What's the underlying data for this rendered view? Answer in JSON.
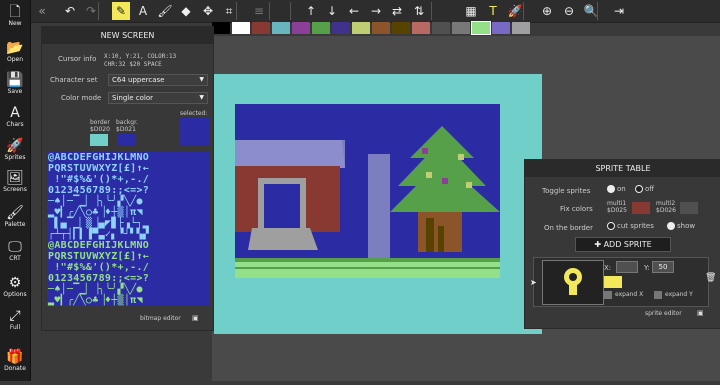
{
  "sidebar": {
    "items": [
      {
        "label": "New",
        "icon": "file-icon",
        "glyph": "🗋"
      },
      {
        "label": "Open",
        "icon": "folder-icon",
        "glyph": "📂"
      },
      {
        "label": "Save",
        "icon": "save-icon",
        "glyph": "💾"
      },
      {
        "label": "Chars",
        "icon": "chars-icon",
        "glyph": "A"
      },
      {
        "label": "Sprites",
        "icon": "rocket-icon",
        "glyph": "🚀"
      },
      {
        "label": "Screens",
        "icon": "image-icon",
        "glyph": "🖼"
      },
      {
        "label": "Palette",
        "icon": "brush-icon",
        "glyph": "🖌"
      },
      {
        "label": "CRT",
        "icon": "monitor-icon",
        "glyph": "🖵"
      },
      {
        "label": "Options",
        "icon": "gear-icon",
        "glyph": "⚙"
      },
      {
        "label": "Full",
        "icon": "expand-icon",
        "glyph": "⤢"
      },
      {
        "label": "Donate",
        "icon": "gift-icon",
        "glyph": "🎁"
      }
    ]
  },
  "toolbar": {
    "collapse_glyph": "«",
    "buttons": [
      {
        "name": "undo-icon",
        "glyph": "↶"
      },
      {
        "name": "redo-icon",
        "glyph": "↷",
        "disabled": true
      },
      {
        "name": "pencil-icon",
        "glyph": "✎",
        "active": true
      },
      {
        "name": "text-icon",
        "glyph": "A"
      },
      {
        "name": "brush-icon",
        "glyph": "🖌"
      },
      {
        "name": "fill-icon",
        "glyph": "◆"
      },
      {
        "name": "move-icon",
        "glyph": "✥"
      },
      {
        "name": "crop-icon",
        "glyph": "⌗"
      },
      {
        "name": "lines-icon",
        "glyph": "≡",
        "disabled": true
      },
      {
        "name": "arrow-up-icon",
        "glyph": "↑"
      },
      {
        "name": "arrow-down-icon",
        "glyph": "↓"
      },
      {
        "name": "arrow-left-icon",
        "glyph": "←"
      },
      {
        "name": "arrow-right-icon",
        "glyph": "→"
      },
      {
        "name": "swap-horizontal-icon",
        "glyph": "⇄"
      },
      {
        "name": "swap-vertical-icon",
        "glyph": "⇅"
      },
      {
        "name": "grid-icon",
        "glyph": "▦"
      },
      {
        "name": "text-mode-icon",
        "glyph": "T",
        "highlight": true
      },
      {
        "name": "sprite-mode-icon",
        "glyph": "🚀",
        "highlight": true
      },
      {
        "name": "zoom-in-icon",
        "glyph": "⊕"
      },
      {
        "name": "zoom-out-icon",
        "glyph": "⊖"
      },
      {
        "name": "zoom-fit-icon",
        "glyph": "🔍"
      },
      {
        "name": "exit-icon",
        "glyph": "⇥"
      }
    ]
  },
  "palette_colors": [
    "#000000",
    "#ffffff",
    "#883932",
    "#67b6bd",
    "#8b3f96",
    "#55a049",
    "#40318d",
    "#bfce72",
    "#8b5429",
    "#574200",
    "#b86962",
    "#505050",
    "#787878",
    "#94e089",
    "#7869c4",
    "#9f9f9f"
  ],
  "new_screen": {
    "title": "NEW SCREEN",
    "cursor_info_label": "Cursor info",
    "cursor_info_line1": "X:10, Y:21, COLOR:13",
    "cursor_info_line2": "CHR:32 $20 SPACE",
    "charset_label": "Character set",
    "charset_value": "C64 uppercase",
    "colormode_label": "Color mode",
    "colormode_value": "Single color",
    "border_label": "border",
    "border_hex": "$D020",
    "background_label": "backgr.",
    "background_hex": "$D021",
    "selected_label": "selected:",
    "border_color": "#70cfc9",
    "background_color": "#2b2ba3",
    "selected_color": "#2b2ba3",
    "char_rows": [
      "@ABCDEFGHIJKLMNO",
      "PQRSTUVWXYZ[£]↑←",
      " !\"#$%&'()*+,-./",
      "0123456789:;<=>?",
      "─♠│─▔▁▏▕╮╰╯▞╲╱●",
      "▂♥▎╭╱╲○♣▕♦┼▒│π◥",
      " ▌▄▔▁▏▒▕▄◤▊├▗└┐▂",
      "┌┴┬┤▎▍▐▀▃✓▖▝┘▘▚▞",
      "@ABCDEFGHIJKLMNO",
      "PQRSTUVWXYZ[£]↑←",
      " !\"#$%&'()*+,-./",
      "0123456789:;<=>?",
      "─♠│─▔▁▏▕╮╰╯▞╲╱●",
      "▂♥▎╭╱╲○♣▕♦┼▒│π◥"
    ],
    "bitmap_editor_label": "bitmap editor"
  },
  "sprite_table": {
    "title": "SPRITE TABLE",
    "toggle_label": "Toggle sprites",
    "on_label": "on",
    "off_label": "off",
    "fix_colors_label": "Fix colors",
    "multi1_label": "multi1",
    "multi1_hex": "$D025",
    "multi2_label": "multi2",
    "multi2_hex": "$D026",
    "multi1_color": "#883932",
    "multi2_color": "#505050",
    "border_label": "On the border",
    "cut_label": "cut sprites",
    "show_label": "show",
    "add_label": "ADD SPRITE",
    "x_label": "X:",
    "y_label": "Y:",
    "y_value": "50",
    "sprite_color": "#f2e85a",
    "expand_x_label": "expand X",
    "expand_y_label": "expand Y",
    "sprite_editor_label": "sprite editor"
  }
}
